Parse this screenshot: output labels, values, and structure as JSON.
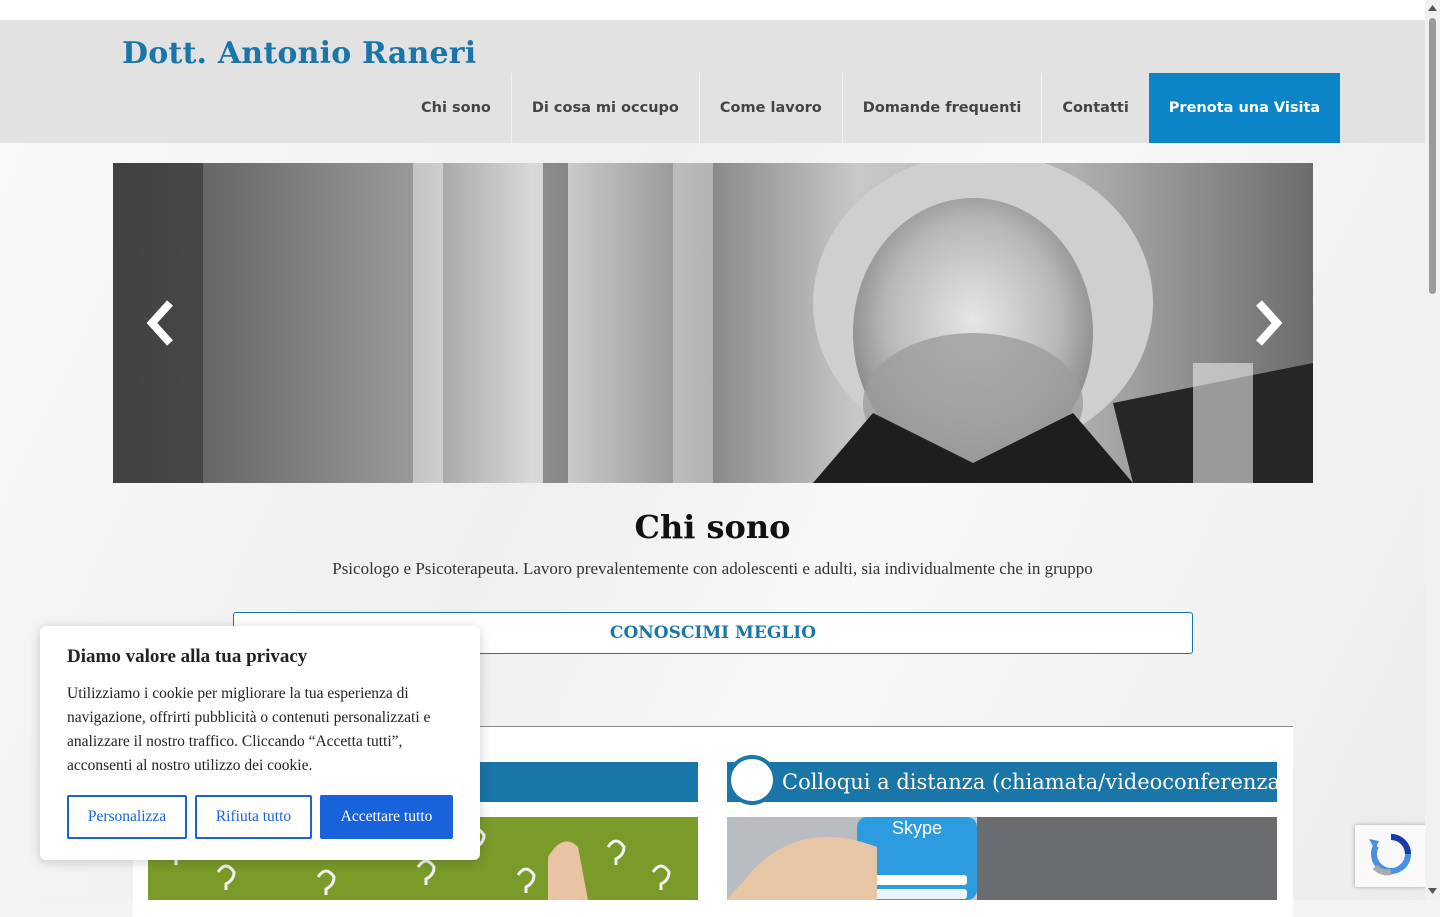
{
  "header": {
    "logo": "Dott. Antonio Raneri",
    "nav": [
      {
        "label": "Chi sono"
      },
      {
        "label": "Di cosa mi occupo"
      },
      {
        "label": "Come lavoro"
      },
      {
        "label": "Domande frequenti"
      },
      {
        "label": "Contatti"
      }
    ],
    "cta_label": "Prenota una Visita"
  },
  "hero": {
    "title": "Chi sono",
    "subtitle": "Psicologo e Psicoterapeuta. Lavoro prevalentemente con adolescenti e adulti, sia individualmente che in gruppo",
    "button_label": "CONOSCIMI MEGLIO"
  },
  "cards": [
    {
      "title": ""
    },
    {
      "title": "Colloqui a distanza (chiamata/videoconferenza)",
      "image_text": "Skype"
    }
  ],
  "cookie_banner": {
    "title": "Diamo valore alla tua privacy",
    "text": "Utilizziamo i cookie per migliorare la tua esperienza di navigazione, offrirti pubblicità o contenuti personalizzati e analizzare il nostro traffico. Cliccando “Accetta tutti”, acconsenti al nostro utilizzo dei cookie.",
    "buttons": {
      "customize": "Personalizza",
      "reject": "Rifiuta tutto",
      "accept": "Accettare tutto"
    }
  },
  "colors": {
    "brand": "#1a75a8",
    "cta": "#0b85c8",
    "cookie_accent": "#1863dc"
  }
}
